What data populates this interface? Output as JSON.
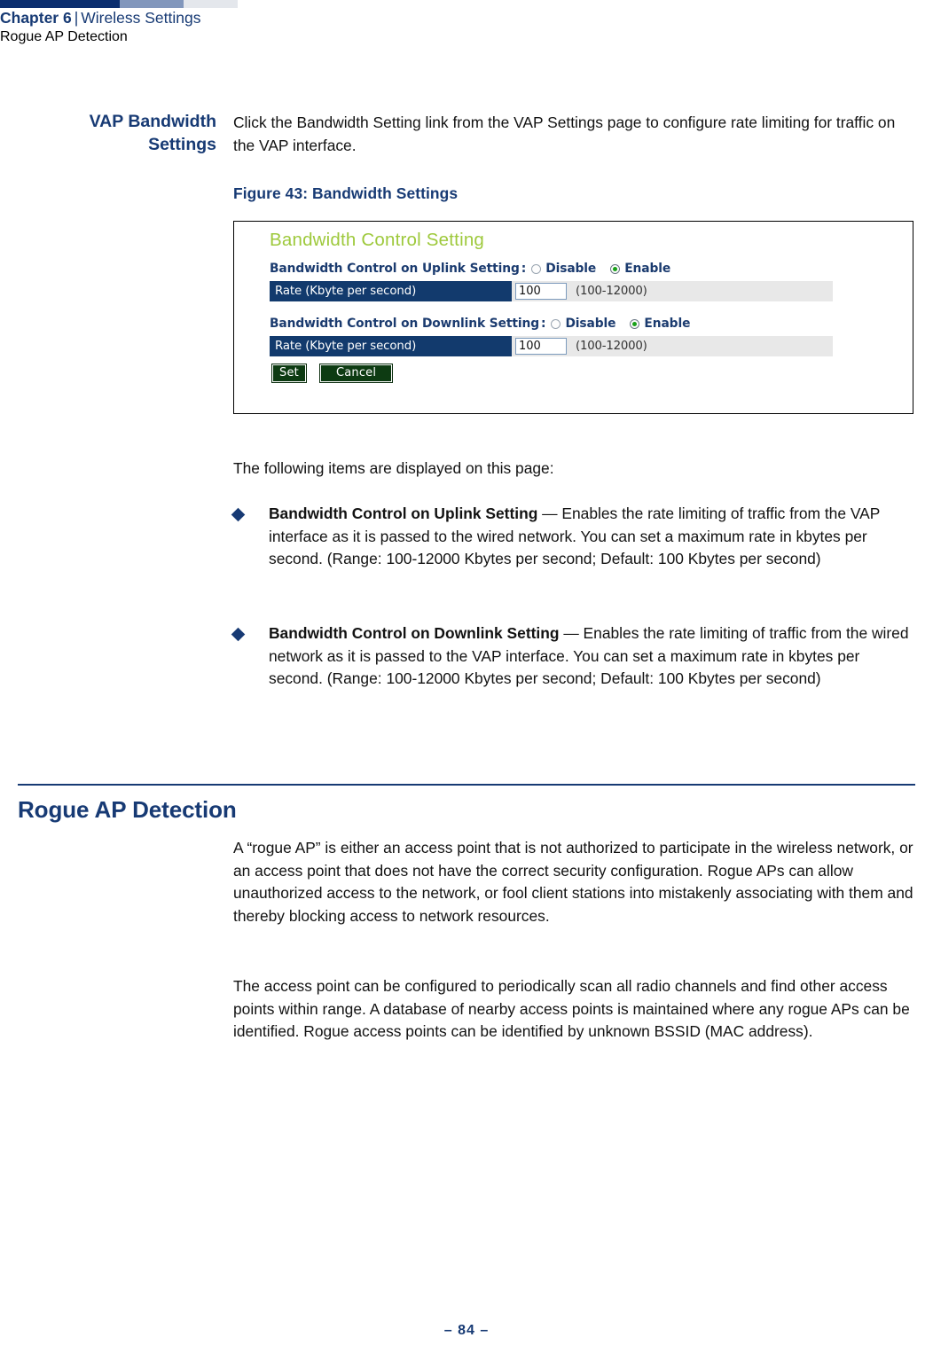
{
  "running_header": {
    "chapter": "Chapter 6",
    "separator": "|",
    "section": "Wireless Settings",
    "subsection": "Rogue AP Detection",
    "bar_colors": [
      "#0a2d6e",
      "#8297bc",
      "#e4e7ec"
    ]
  },
  "marginal_heading": {
    "line1": "VAP Bandwidth",
    "line2": "Settings"
  },
  "intro_paragraph": "Click the Bandwidth Setting link from the VAP Settings page to configure rate limiting for traffic on the VAP interface.",
  "figure": {
    "caption": "Figure 43:  Bandwidth Settings",
    "screen": {
      "title": "Bandwidth Control Setting",
      "title_color": "#9ec93c",
      "uplink": {
        "label": "Bandwidth Control on Uplink Setting",
        "colon": ":",
        "option_disable": "Disable",
        "option_enable": "Enable",
        "selected": "Enable",
        "rate_label": "Rate (Kbyte per second)",
        "rate_value": "100",
        "rate_range": "(100-12000)"
      },
      "downlink": {
        "label": "Bandwidth Control on Downlink Setting",
        "colon": ":",
        "option_disable": "Disable",
        "option_enable": "Enable",
        "selected": "Enable",
        "rate_label": "Rate (Kbyte per second)",
        "rate_value": "100",
        "rate_range": "(100-12000)"
      },
      "buttons": {
        "set": "Set",
        "cancel": "Cancel"
      }
    }
  },
  "items_intro": "The following items are displayed on this page:",
  "bullets": [
    {
      "term": "Bandwidth Control on Uplink Setting",
      "dash": " — ",
      "description": "Enables the rate limiting of traffic from the VAP interface as it is passed to the wired network. You can set a maximum rate in kbytes per second. (Range: 100-12000 Kbytes per second; Default: 100 Kbytes per second)"
    },
    {
      "term": "Bandwidth Control on Downlink Setting",
      "dash": " — ",
      "description": "Enables the rate limiting of traffic from the wired network as it is passed to the VAP interface. You can set a maximum rate in kbytes per second. (Range: 100-12000 Kbytes per second; Default: 100 Kbytes per second)"
    }
  ],
  "section": {
    "heading": "Rogue AP Detection",
    "paragraph1": "A “rogue AP” is either an access point that is not authorized to participate in the wireless network, or an access point that does not have the correct security configuration. Rogue APs can allow unauthorized access to the network, or  fool client stations into mistakenly associating with them and thereby blocking access to network resources.",
    "paragraph2": "The access point can be configured to periodically scan all radio channels and find other access points within range. A database of nearby access points is maintained where any rogue APs can be identified. Rogue access points can be identified by unknown BSSID (MAC address)."
  },
  "footer": {
    "page_number": "–  84  –"
  },
  "colors": {
    "navy": "#173a74",
    "panel_navy": "#123a6d",
    "accent_green": "#9ec93c",
    "button_green": "#0d3b12",
    "radio_green": "#18a018"
  }
}
